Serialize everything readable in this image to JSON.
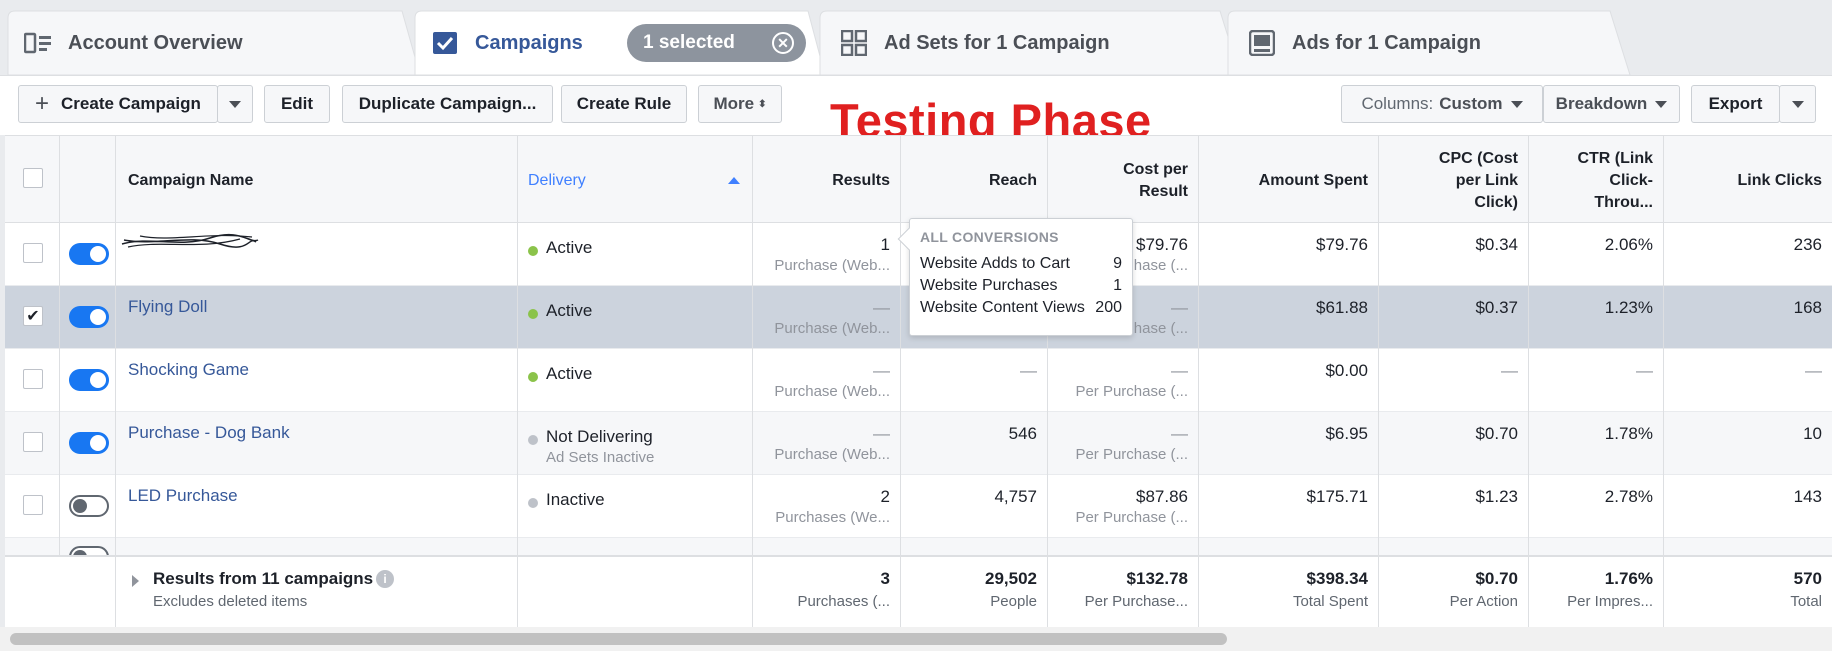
{
  "tabs": [
    {
      "label": "Account Overview",
      "icon": "account-overview-icon"
    },
    {
      "label": "Campaigns",
      "icon": "checkbox-icon",
      "active": true
    },
    {
      "label": "Ad Sets for 1 Campaign",
      "icon": "grid-icon"
    },
    {
      "label": "Ads for 1 Campaign",
      "icon": "ad-icon"
    }
  ],
  "selection": {
    "label": "1 selected"
  },
  "toolbar": {
    "create": "Create Campaign",
    "edit": "Edit",
    "duplicate": "Duplicate Campaign...",
    "create_rule": "Create Rule",
    "more": "More",
    "columns_prefix": "Columns:",
    "columns_value": "Custom",
    "breakdown": "Breakdown",
    "export": "Export"
  },
  "annotation": "Testing Phase",
  "headers": {
    "name": "Campaign Name",
    "delivery": "Delivery",
    "results": "Results",
    "reach": "Reach",
    "cost_per_result": [
      "Cost per",
      "Result"
    ],
    "amount_spent": "Amount Spent",
    "cpc": [
      "CPC (Cost",
      "per Link",
      "Click)"
    ],
    "ctr": [
      "CTR (Link",
      "Click-",
      "Throu..."
    ],
    "link_clicks": "Link Clicks"
  },
  "rows": [
    {
      "name": "",
      "delivery": "Active",
      "delivery_sub": "",
      "results": "1",
      "results_sub": "Purchase (Web...",
      "reach": "",
      "cost": "$79.76",
      "cost_sub": "hase (...",
      "spent": "$79.76",
      "cpc": "$0.34",
      "ctr": "2.06%",
      "clicks": "236"
    },
    {
      "name": "Flying Doll",
      "delivery": "Active",
      "delivery_sub": "",
      "results": "—",
      "results_sub": "Purchase (Web...",
      "reach": "",
      "cost": "—",
      "cost_sub": "hase (...",
      "spent": "$61.88",
      "cpc": "$0.37",
      "ctr": "1.23%",
      "clicks": "168"
    },
    {
      "name": "Shocking Game",
      "delivery": "Active",
      "delivery_sub": "",
      "results": "—",
      "results_sub": "Purchase (Web...",
      "reach": "—",
      "cost": "—",
      "cost_sub": "Per Purchase (...",
      "spent": "$0.00",
      "cpc": "—",
      "ctr": "—",
      "clicks": "—"
    },
    {
      "name": "Purchase - Dog Bank",
      "delivery": "Not Delivering",
      "delivery_sub": "Ad Sets Inactive",
      "results": "—",
      "results_sub": "Purchase (Web...",
      "reach": "546",
      "cost": "—",
      "cost_sub": "Per Purchase (...",
      "spent": "$6.95",
      "cpc": "$0.70",
      "ctr": "1.78%",
      "clicks": "10"
    },
    {
      "name": "LED Purchase",
      "delivery": "Inactive",
      "delivery_sub": "",
      "results": "2",
      "results_sub": "Purchases (We...",
      "reach": "4,757",
      "cost": "$87.86",
      "cost_sub": "Per Purchase (...",
      "spent": "$175.71",
      "cpc": "$1.23",
      "ctr": "2.78%",
      "clicks": "143"
    }
  ],
  "summary": {
    "title": "Results from 11 campaigns",
    "subtitle": "Excludes deleted items",
    "results": "3",
    "results_sub": "Purchases (...",
    "reach": "29,502",
    "reach_sub": "People",
    "cost": "$132.78",
    "cost_sub": "Per Purchase...",
    "spent": "$398.34",
    "spent_sub": "Total Spent",
    "cpc": "$0.70",
    "cpc_sub": "Per Action",
    "ctr": "1.76%",
    "ctr_sub": "Per Impres...",
    "clicks": "570",
    "clicks_sub": "Total"
  },
  "tooltip": {
    "title": "ALL CONVERSIONS",
    "items": [
      {
        "label": "Website Adds to Cart",
        "value": "9"
      },
      {
        "label": "Website Purchases",
        "value": "1"
      },
      {
        "label": "Website Content Views",
        "value": "200"
      }
    ]
  }
}
